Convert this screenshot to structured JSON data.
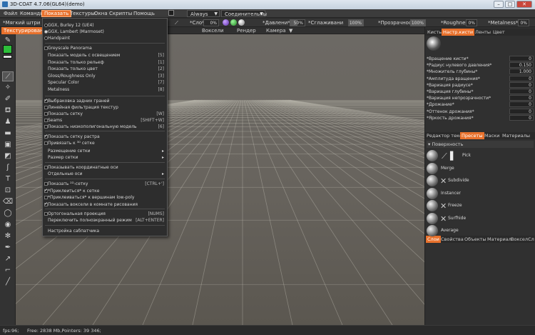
{
  "window": {
    "title": "3D-COAT 4.7.06(GL64)(demo)"
  },
  "menubar": {
    "items": [
      "Файл",
      "Команды",
      "Показать",
      "Текстуры",
      "Окна",
      "Скрипты",
      "Помощь"
    ],
    "combo_always": "Always",
    "combo_conn": "Соединительны"
  },
  "toolbar": {
    "brush_label": "*Мягкий штри",
    "sloi_label": "*Сло*",
    "sloi_value": "0%",
    "davlenie_label": "*Давлени*",
    "davlenie_value": "50%",
    "sglazh_label": "*Сглаживани",
    "sglazh_value": "100%",
    "prozr_label": "*Прозрачност*",
    "prozr_value": "100%",
    "rough_label": "*Roughnes",
    "rough_value": "0%",
    "metal_label": "*Metalness*",
    "metal_value": "0%"
  },
  "tabs": [
    "Текстурирован",
    "Воксели",
    "Рендер",
    "Камера"
  ],
  "dropdown": {
    "radio": [
      {
        "label": "GGX, Burley 12 (UE4)",
        "on": false
      },
      {
        "label": "GGX, Lambert (Marmoset)",
        "on": true
      },
      {
        "label": "Handpaint",
        "on": false
      }
    ],
    "greyscale": "Greyscale Panorama",
    "display_modes": [
      {
        "label": "Показать модель с освещением",
        "sc": "[5]"
      },
      {
        "label": "Показать только рельеф",
        "sc": "[1]"
      },
      {
        "label": "Показать только цвет",
        "sc": "[2]"
      },
      {
        "label": "Gloss/Roughness Only",
        "sc": "[3]"
      },
      {
        "label": "Specular Color",
        "sc": "[7]"
      },
      {
        "label": "Metalness",
        "sc": "[8]"
      }
    ],
    "options1": [
      {
        "label": "Выбраковка задних граней",
        "on": true,
        "sc": ""
      },
      {
        "label": "Линейная фильтрация текстур",
        "on": false,
        "sc": ""
      },
      {
        "label": "Показать сетку",
        "on": false,
        "sc": "[W]"
      },
      {
        "label": "Seams",
        "on": false,
        "sc": "[SHIFT+W]"
      },
      {
        "label": "Показать низкополигональную модель",
        "on": false,
        "sc": "[6]"
      }
    ],
    "options2": [
      {
        "label": "Показать сетку растра",
        "on": true
      },
      {
        "label": "Привязать к ³ᴰ сетке",
        "on": false
      }
    ],
    "grid_placement": "Размещение сетки",
    "grid_size": "Размер сетки",
    "show_coord_axes": "Показывать координатные оси",
    "separate_axes": "Отдельные оси",
    "options3": [
      {
        "label": "Показать ²ᴰ-сетку",
        "on": false,
        "sc": "[CTRL+']"
      },
      {
        "label": "*Приклеиться* к сетке",
        "on": true,
        "sc": ""
      },
      {
        "label": "*Приклеиваться* к вершинам low-poly",
        "on": false,
        "sc": ""
      },
      {
        "label": "Показать воксели в комнате рисования",
        "on": true,
        "sc": ""
      }
    ],
    "ortho": {
      "label": "Ортогональная проекция",
      "sc": "[NUMS]"
    },
    "fullscreen": {
      "label": "Переключить полноэкранный режим",
      "sc": "[ALT+ENTER]"
    },
    "spacemouse": "Настройка сабпатчика"
  },
  "rightpanel": {
    "tabs_top": [
      "Кисть",
      "Настр.кисти",
      "Ленты",
      "Цвет"
    ],
    "params": [
      {
        "name": "*Вращение кисти*",
        "value": "0"
      },
      {
        "name": "*Радиус нулевого давления*",
        "value": "0.150"
      },
      {
        "name": "*Множитель глубины*",
        "value": "1.000"
      },
      {
        "name": "*Амплитуда вращения*",
        "value": "0"
      },
      {
        "name": "*Вариация радиусе*",
        "value": "0"
      },
      {
        "name": "*Вариация глубины*",
        "value": "0"
      },
      {
        "name": "*Вариация непрозрачности*",
        "value": "0"
      },
      {
        "name": "*Дрожание*",
        "value": "0"
      },
      {
        "name": "*Оттенок дрожания*",
        "value": "0"
      },
      {
        "name": "*Яркость дрожания*",
        "value": "0"
      }
    ],
    "tabs_mid": [
      "Редактор текс",
      "Пресеты",
      "Маски",
      "Материалы"
    ],
    "preset_header": "Поверхность",
    "presets": [
      "Pick",
      "Merge",
      "Subdivide",
      "Instancer",
      "Freeze",
      "Surfhide",
      "Average"
    ],
    "tabs_bottom": [
      "Слои",
      "Свойства",
      "Объекты",
      "Материал",
      "ВокселСл"
    ]
  },
  "status": {
    "fps": "fps:96;",
    "free": "Free: 2838 Mb,Pointers: 39 346;"
  },
  "colors": {
    "accent": "#e8712c",
    "primary_color": "#2dbf3a"
  }
}
